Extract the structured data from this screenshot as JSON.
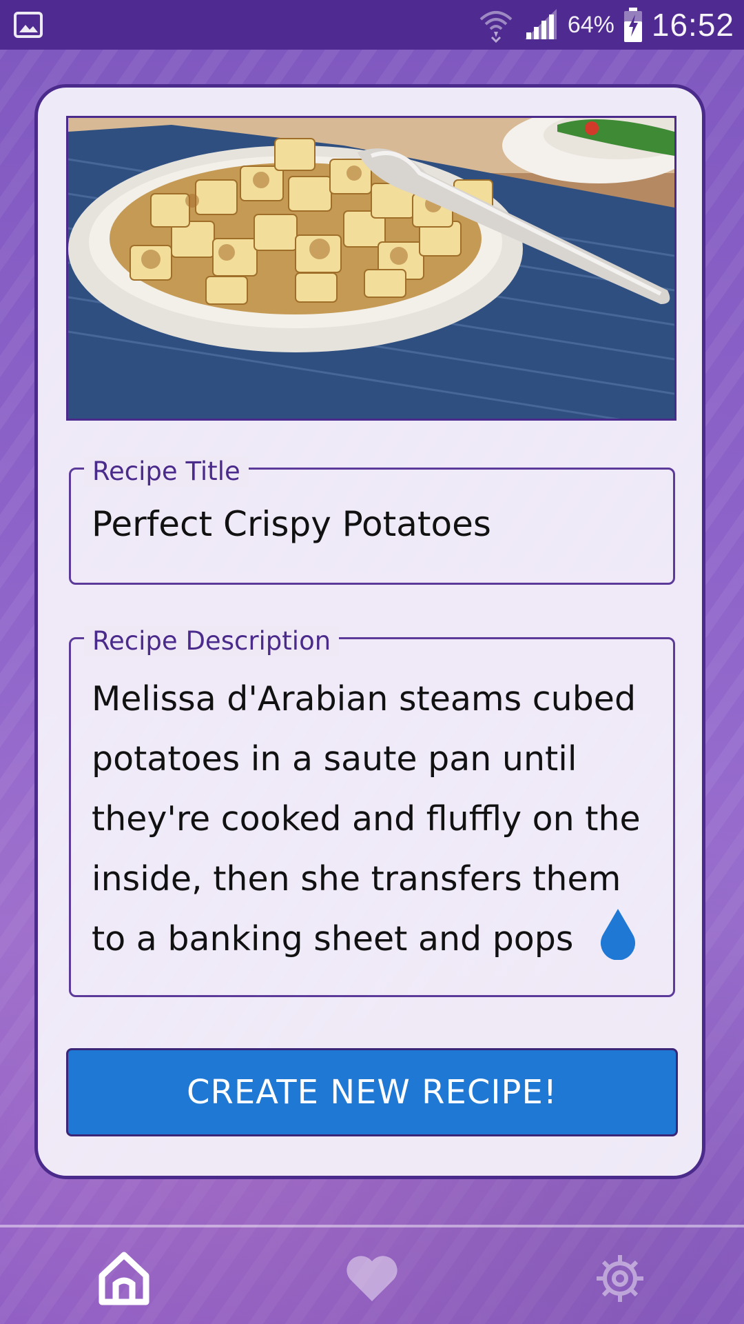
{
  "status_bar": {
    "battery_percent": "64%",
    "time": "16:52",
    "icons": [
      "gallery-icon",
      "wifi-icon",
      "signal-icon",
      "battery-charging-icon"
    ]
  },
  "recipe_image": {
    "icon": "food-photo"
  },
  "form": {
    "title_label": "Recipe Title",
    "title_value": "Perfect Crispy Potatoes",
    "description_label": "Recipe Description",
    "description_value": "Melissa d'Arabian steams cubed potatoes in a saute pan until they're cooked and fluffly on the inside, then she transfers them to a banking sheet and pops"
  },
  "actions": {
    "create_button": "CREATE NEW RECIPE!"
  },
  "bottom_nav": {
    "items": [
      {
        "icon": "home-icon",
        "active": true
      },
      {
        "icon": "heart-icon",
        "active": false
      },
      {
        "icon": "gear-icon",
        "active": false
      }
    ]
  },
  "colors": {
    "status_bar": "#4f2a91",
    "card_border": "#4a2a8a",
    "label": "#4a2a8a",
    "button": "#1f78d4",
    "background": "#8d63c9"
  }
}
